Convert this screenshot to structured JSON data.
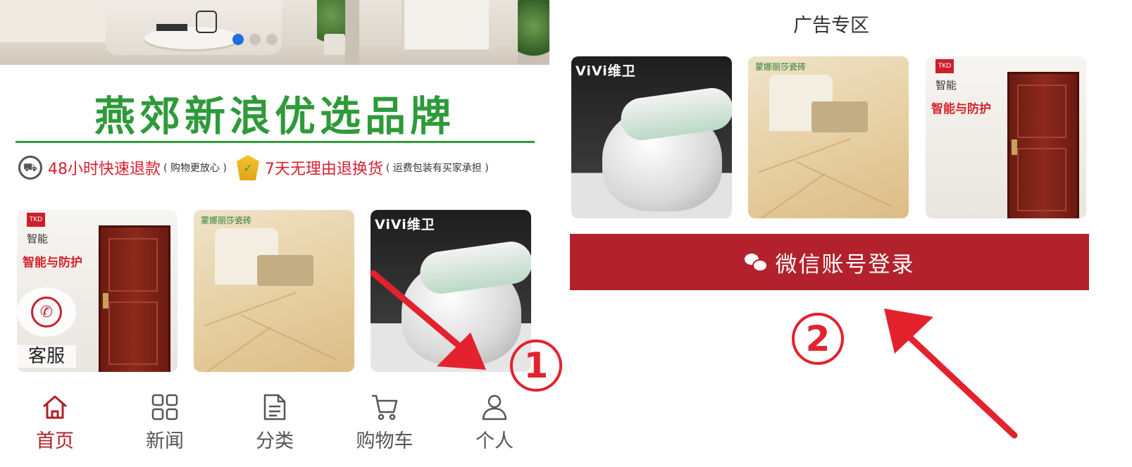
{
  "left": {
    "brand_title": "燕郊新浪优选品牌",
    "promo": {
      "refund_text": "48小时快速退款",
      "refund_note": "( 购物更放心 )",
      "return_text": "7天无理由退换货",
      "return_note": "( 运费包装有买家承担 )"
    },
    "products": [
      {
        "name": "door",
        "brand_logo": "TKD",
        "badge": "智能",
        "slogan": "智能与防护"
      },
      {
        "name": "tile",
        "brand_logo": "蒙娜丽莎瓷砖"
      },
      {
        "name": "toilet",
        "brand_logo": "ViVi维卫"
      }
    ],
    "service_label": "客服",
    "nav": [
      {
        "label": "首页",
        "icon": "home-icon",
        "active": true
      },
      {
        "label": "新闻",
        "icon": "grid-icon"
      },
      {
        "label": "分类",
        "icon": "document-icon"
      },
      {
        "label": "购物车",
        "icon": "cart-icon"
      },
      {
        "label": "个人",
        "icon": "user-icon"
      }
    ]
  },
  "right": {
    "ad_heading": "广告专区",
    "ads": [
      {
        "name": "toilet",
        "brand_logo": "ViVi维卫"
      },
      {
        "name": "tile",
        "brand_logo": "蒙娜丽莎瓷砖"
      },
      {
        "name": "door",
        "brand_logo": "TKD",
        "badge": "智能",
        "slogan": "智能与防护"
      }
    ],
    "login_button": "微信账号登录"
  },
  "annotations": {
    "step1": "1",
    "step2": "2",
    "color": "#e3222d"
  },
  "colors": {
    "brand_green": "#2e9a3a",
    "accent_red": "#b3222c",
    "promo_red": "#d81e2e",
    "slider_active": "#1f6fe0"
  }
}
